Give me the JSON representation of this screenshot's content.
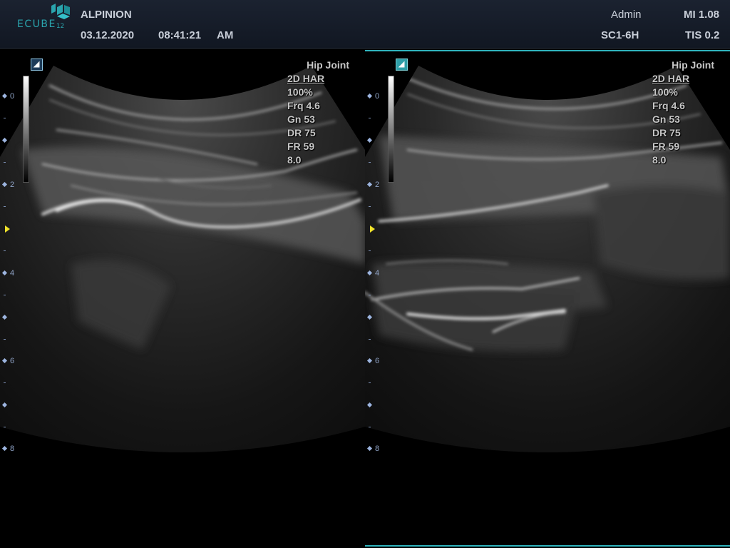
{
  "header": {
    "logo_text": "ECUBE",
    "logo_number": "12",
    "brand": "ALPINION",
    "date": "03.12.2020",
    "time": "08:41:21",
    "ampm": "AM",
    "user": "Admin",
    "probe": "SC1-6H",
    "mi": "MI 1.08",
    "tis": "TIS 0.2"
  },
  "colors": {
    "accent": "#2fb3bd",
    "focus_marker": "#f0e22a",
    "depth_scale": "#8fa3c6"
  },
  "depth_scale": [
    {
      "label": "0"
    },
    {
      "label": ""
    },
    {
      "label": ""
    },
    {
      "label": ""
    },
    {
      "label": "2"
    },
    {
      "label": ""
    },
    {
      "label": ""
    },
    {
      "label": ""
    },
    {
      "label": "4"
    },
    {
      "label": ""
    },
    {
      "label": ""
    },
    {
      "label": ""
    },
    {
      "label": "6"
    },
    {
      "label": ""
    },
    {
      "label": ""
    },
    {
      "label": ""
    },
    {
      "label": "8"
    }
  ],
  "panels": [
    {
      "preset": "Hip Joint",
      "mode": "2D HAR",
      "power": "100%",
      "frequency": "Frq 4.6",
      "gain": "Gn 53",
      "dynamic_range": "DR 75",
      "frame_rate": "FR 59",
      "depth": "8.0",
      "active": false
    },
    {
      "preset": "Hip Joint",
      "mode": "2D HAR",
      "power": "100%",
      "frequency": "Frq 4.6",
      "gain": "Gn 53",
      "dynamic_range": "DR 75",
      "frame_rate": "FR 59",
      "depth": "8.0",
      "active": true
    }
  ]
}
